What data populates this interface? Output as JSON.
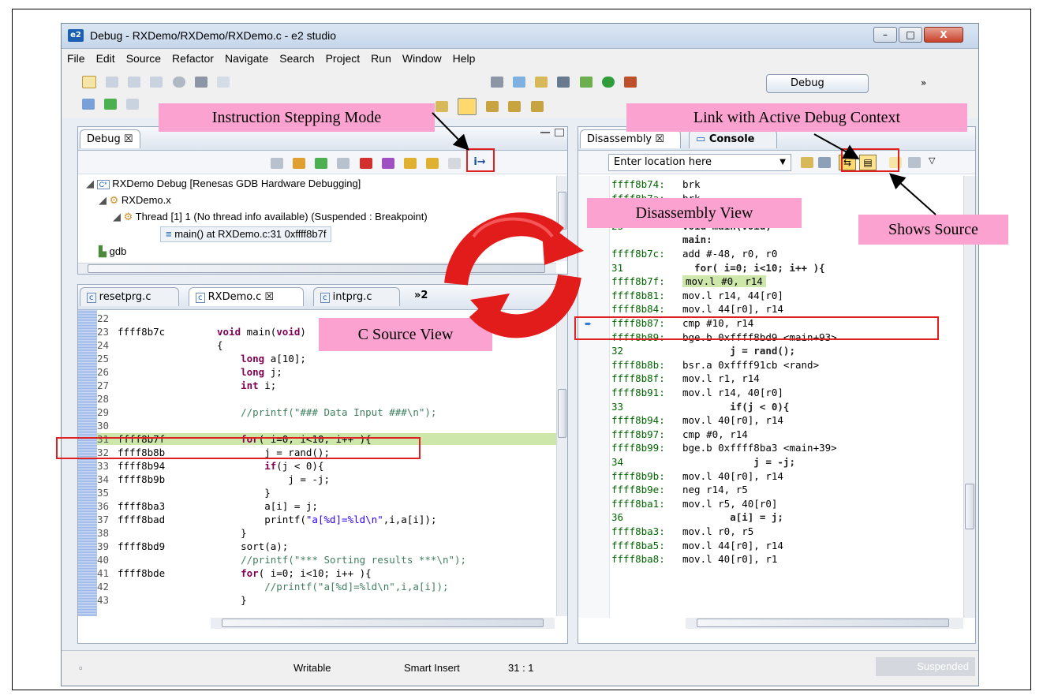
{
  "window": {
    "title": "Debug - RXDemo/RXDemo/RXDemo.c - e2 studio",
    "app_badge": "e2",
    "controls": [
      "–",
      "□",
      "X"
    ]
  },
  "menu": [
    "File",
    "Edit",
    "Source",
    "Refactor",
    "Navigate",
    "Search",
    "Project",
    "Run",
    "Window",
    "Help"
  ],
  "perspective": {
    "label": "Debug",
    "more": "»"
  },
  "debug_view": {
    "tab": "Debug ☒",
    "tree": [
      {
        "text": "RXDemo Debug [Renesas GDB Hardware Debugging]",
        "badge": "C*"
      },
      {
        "text": "RXDemo.x"
      },
      {
        "text": "Thread [1] 1 (No thread info available) (Suspended : Breakpoint)"
      },
      {
        "text": "main() at RXDemo.c:31 0xffff8b7f"
      },
      {
        "text": "gdb"
      }
    ]
  },
  "editor": {
    "tabs": [
      "resetprg.c",
      "RXDemo.c ☒",
      "intprg.c",
      "»2"
    ],
    "lines": [
      {
        "n": "22",
        "addr": "",
        "code": ""
      },
      {
        "n": "23",
        "addr": "ffff8b7c",
        "code": "void main(void)"
      },
      {
        "n": "24",
        "addr": "",
        "code": "{"
      },
      {
        "n": "25",
        "addr": "",
        "code": "    long a[10];"
      },
      {
        "n": "26",
        "addr": "",
        "code": "    long j;"
      },
      {
        "n": "27",
        "addr": "",
        "code": "    int i;"
      },
      {
        "n": "28",
        "addr": "",
        "code": ""
      },
      {
        "n": "29",
        "addr": "",
        "code": "    //printf(\"### Data Input ###\\n\");"
      },
      {
        "n": "30",
        "addr": "",
        "code": ""
      },
      {
        "n": "31",
        "addr": "ffff8b7f",
        "code": "    for( i=0; i<10; i++ ){"
      },
      {
        "n": "32",
        "addr": "ffff8b8b",
        "code": "        j = rand();"
      },
      {
        "n": "33",
        "addr": "ffff8b94",
        "code": "        if(j < 0){"
      },
      {
        "n": "34",
        "addr": "ffff8b9b",
        "code": "            j = -j;"
      },
      {
        "n": "35",
        "addr": "",
        "code": "        }"
      },
      {
        "n": "36",
        "addr": "ffff8ba3",
        "code": "        a[i] = j;"
      },
      {
        "n": "37",
        "addr": "ffff8bad",
        "code": "        printf(\"a[%d]=%ld\\n\",i,a[i]);"
      },
      {
        "n": "38",
        "addr": "",
        "code": "    }"
      },
      {
        "n": "39",
        "addr": "ffff8bd9",
        "code": "    sort(a);"
      },
      {
        "n": "40",
        "addr": "",
        "code": "    //printf(\"*** Sorting results ***\\n\");"
      },
      {
        "n": "41",
        "addr": "ffff8bde",
        "code": "    for( i=0; i<10; i++ ){"
      },
      {
        "n": "42",
        "addr": "",
        "code": "        //printf(\"a[%d]=%ld\\n\",i,a[i]);"
      },
      {
        "n": "43",
        "addr": "",
        "code": "    }"
      }
    ]
  },
  "disassembly": {
    "tabs": [
      "Disassembly ☒",
      "Console"
    ],
    "location_placeholder": "Enter location here",
    "lines": [
      {
        "a": "ffff8b74:",
        "t": "brk"
      },
      {
        "a": "ffff8b7a:",
        "t": "brk"
      },
      {
        "a": "ffff8b7b:",
        "t": "brk"
      },
      {
        "a": "23",
        "t": "void main(void)"
      },
      {
        "a": "",
        "t": "main:"
      },
      {
        "a": "ffff8b7c:",
        "t": "add #-48, r0, r0"
      },
      {
        "a": "31",
        "t": "  for( i=0; i<10; i++ ){"
      },
      {
        "a": "ffff8b7f:",
        "t": "mov.l #0, r14"
      },
      {
        "a": "ffff8b81:",
        "t": "mov.l r14, 44[r0]"
      },
      {
        "a": "ffff8b84:",
        "t": "mov.l 44[r0], r14"
      },
      {
        "a": "ffff8b87:",
        "t": "cmp #10, r14"
      },
      {
        "a": "ffff8b89:",
        "t": "bge.b 0xffff8bd9 <main+93>"
      },
      {
        "a": "32",
        "t": "        j = rand();"
      },
      {
        "a": "ffff8b8b:",
        "t": "bsr.a 0xffff91cb <rand>"
      },
      {
        "a": "ffff8b8f:",
        "t": "mov.l r1, r14"
      },
      {
        "a": "ffff8b91:",
        "t": "mov.l r14, 40[r0]"
      },
      {
        "a": "33",
        "t": "        if(j < 0){"
      },
      {
        "a": "ffff8b94:",
        "t": "mov.l 40[r0], r14"
      },
      {
        "a": "ffff8b97:",
        "t": "cmp #0, r14"
      },
      {
        "a": "ffff8b99:",
        "t": "bge.b 0xffff8ba3 <main+39>"
      },
      {
        "a": "34",
        "t": "            j = -j;"
      },
      {
        "a": "ffff8b9b:",
        "t": "mov.l 40[r0], r14"
      },
      {
        "a": "ffff8b9e:",
        "t": "neg r14, r5"
      },
      {
        "a": "ffff8ba1:",
        "t": "mov.l r5, 40[r0]"
      },
      {
        "a": "36",
        "t": "        a[i] = j;"
      },
      {
        "a": "ffff8ba3:",
        "t": "mov.l r0, r5"
      },
      {
        "a": "ffff8ba5:",
        "t": "mov.l 44[r0], r14"
      },
      {
        "a": "ffff8ba8:",
        "t": "mov.l 40[r0], r1"
      }
    ]
  },
  "status": {
    "mode": "Writable",
    "insert": "Smart Insert",
    "position": "31 : 1",
    "state": "Suspended"
  },
  "callouts": {
    "instruction_stepping": "Instruction Stepping Mode",
    "link_context": "Link with Active Debug Context",
    "disassembly_view": "Disassembly View",
    "shows_source": "Shows Source",
    "c_source_view": "C Source View"
  },
  "colors": {
    "callout": "#fba2d0",
    "highlight": "#cde6a9",
    "frame": "#e02020"
  }
}
